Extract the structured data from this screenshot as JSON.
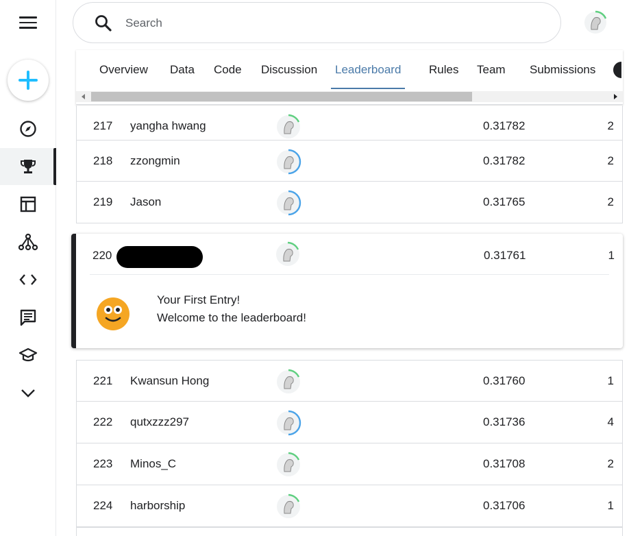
{
  "search": {
    "placeholder": "Search"
  },
  "nav": {
    "items": [
      {
        "name": "explore",
        "icon": "compass-icon",
        "active": false
      },
      {
        "name": "competitions",
        "icon": "trophy-icon",
        "active": true
      },
      {
        "name": "datasets",
        "icon": "table-icon",
        "active": false
      },
      {
        "name": "models",
        "icon": "network-icon",
        "active": false
      },
      {
        "name": "code",
        "icon": "code-icon",
        "active": false
      },
      {
        "name": "discussions",
        "icon": "comment-icon",
        "active": false
      },
      {
        "name": "learn",
        "icon": "school-icon",
        "active": false
      },
      {
        "name": "more",
        "icon": "chevron-down-icon",
        "active": false
      }
    ]
  },
  "tabs": [
    {
      "label": "Overview"
    },
    {
      "label": "Data"
    },
    {
      "label": "Code"
    },
    {
      "label": "Discussion"
    },
    {
      "label": "Leaderboard",
      "active": true
    },
    {
      "label": "Rules"
    },
    {
      "label": "Team"
    },
    {
      "label": "Submissions"
    }
  ],
  "rows_before": [
    {
      "rank": "217",
      "name": "yangha hwang",
      "score": "0.31782",
      "entries": "2",
      "ring": "green"
    },
    {
      "rank": "218",
      "name": "zzongmin",
      "score": "0.31782",
      "entries": "2",
      "ring": "blue"
    },
    {
      "rank": "219",
      "name": "Jason",
      "score": "0.31765",
      "entries": "2",
      "ring": "blue"
    }
  ],
  "highlight": {
    "rank": "220",
    "score": "0.31761",
    "entries": "1",
    "message_line1": "Your First Entry!",
    "message_line2": "Welcome to the leaderboard!"
  },
  "rows_after": [
    {
      "rank": "221",
      "name": "Kwansun Hong",
      "score": "0.31760",
      "entries": "1",
      "ring": "green"
    },
    {
      "rank": "222",
      "name": "qutxzzz297",
      "score": "0.31736",
      "entries": "4",
      "ring": "blue"
    },
    {
      "rank": "223",
      "name": "Minos_C",
      "score": "0.31708",
      "entries": "2",
      "ring": "green"
    },
    {
      "rank": "224",
      "name": "harborship",
      "score": "0.31706",
      "entries": "1",
      "ring": "green"
    }
  ],
  "colors": {
    "accent": "#4a7aa8",
    "create": "#20beff",
    "ring_green": "#5fcf80",
    "ring_blue": "#4aa3e8",
    "emoji": "#f5a623"
  }
}
